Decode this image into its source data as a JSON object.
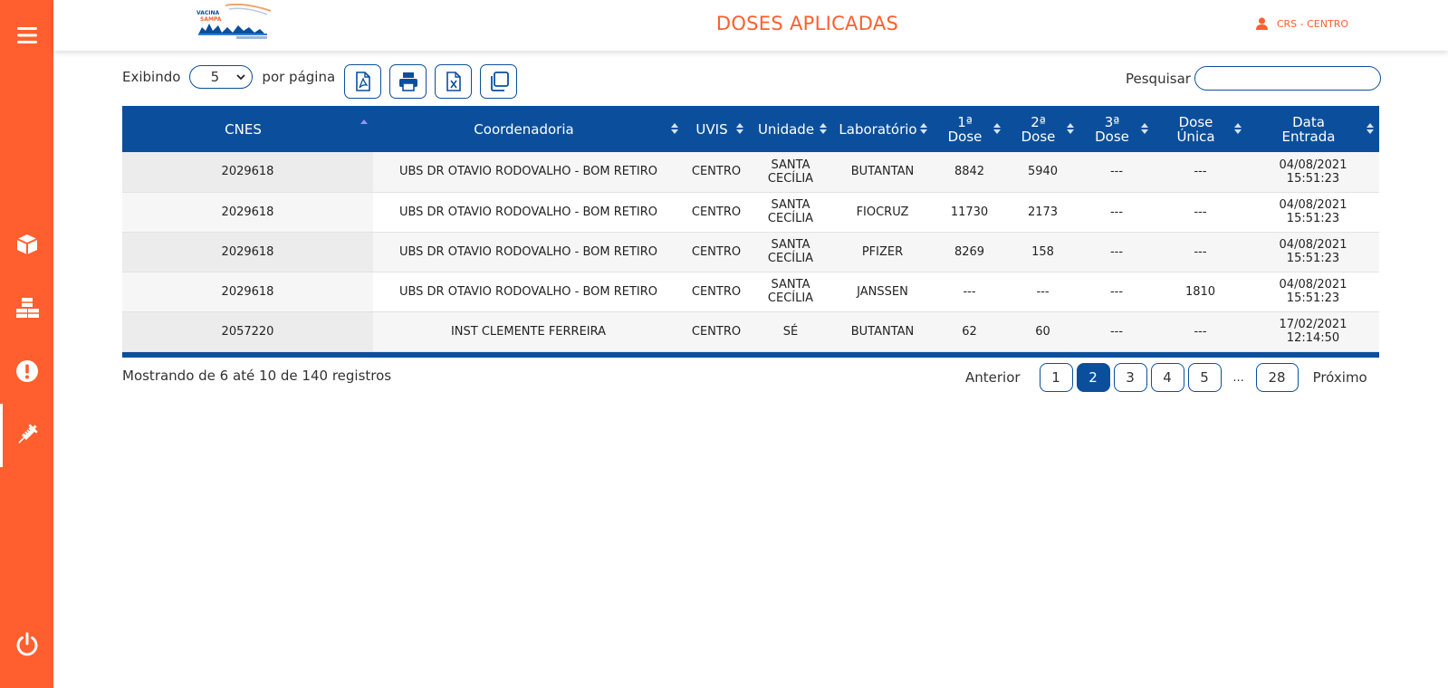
{
  "header": {
    "title": "DOSES APLICADAS",
    "user": "CRS - CENTRO",
    "logo_text": "VACINA SAMPA"
  },
  "sidebar": {
    "items": [
      {
        "icon": "menu-icon"
      },
      {
        "icon": "box-icon"
      },
      {
        "icon": "boxes-icon"
      },
      {
        "icon": "alert-icon"
      },
      {
        "icon": "syringe-icon",
        "active": true
      },
      {
        "icon": "power-icon"
      }
    ]
  },
  "toolbar": {
    "showing_label": "Exibindo",
    "per_page_value": "5",
    "per_page_label": "por página",
    "buttons": [
      "pdf-icon",
      "print-icon",
      "excel-icon",
      "copy-icon"
    ]
  },
  "search": {
    "label": "Pesquisar",
    "value": ""
  },
  "table": {
    "columns": [
      {
        "label": "CNES",
        "sort": "asc"
      },
      {
        "label": "Coordenadoria",
        "sort": "both"
      },
      {
        "label": "UVIS",
        "sort": "both"
      },
      {
        "label": "Unidade",
        "sort": "both"
      },
      {
        "label": "Laboratório",
        "sort": "both"
      },
      {
        "label": "1ª Dose",
        "line1": "1ª",
        "line2": "Dose",
        "sort": "both"
      },
      {
        "label": "2ª Dose",
        "line1": "2ª",
        "line2": "Dose",
        "sort": "both"
      },
      {
        "label": "3ª Dose",
        "line1": "3ª",
        "line2": "Dose",
        "sort": "both"
      },
      {
        "label": "Dose Única",
        "line1": "Dose",
        "line2": "Única",
        "sort": "both"
      },
      {
        "label": "Data Entrada",
        "line1": "Data",
        "line2": "Entrada",
        "sort": "both"
      }
    ],
    "rows": [
      {
        "cnes": "2029618",
        "coordenadoria": "UBS DR OTAVIO RODOVALHO - BOM RETIRO",
        "uvis": "CENTRO",
        "unidade1": "SANTA",
        "unidade2": "CECÍLIA",
        "laboratorio": "BUTANTAN",
        "dose1": "8842",
        "dose2": "5940",
        "dose3": "---",
        "unica": "---",
        "data": "04/08/2021",
        "hora": "15:51:23"
      },
      {
        "cnes": "2029618",
        "coordenadoria": "UBS DR OTAVIO RODOVALHO - BOM RETIRO",
        "uvis": "CENTRO",
        "unidade1": "SANTA",
        "unidade2": "CECÍLIA",
        "laboratorio": "FIOCRUZ",
        "dose1": "11730",
        "dose2": "2173",
        "dose3": "---",
        "unica": "---",
        "data": "04/08/2021",
        "hora": "15:51:23"
      },
      {
        "cnes": "2029618",
        "coordenadoria": "UBS DR OTAVIO RODOVALHO - BOM RETIRO",
        "uvis": "CENTRO",
        "unidade1": "SANTA",
        "unidade2": "CECÍLIA",
        "laboratorio": "PFIZER",
        "dose1": "8269",
        "dose2": "158",
        "dose3": "---",
        "unica": "---",
        "data": "04/08/2021",
        "hora": "15:51:23"
      },
      {
        "cnes": "2029618",
        "coordenadoria": "UBS DR OTAVIO RODOVALHO - BOM RETIRO",
        "uvis": "CENTRO",
        "unidade1": "SANTA",
        "unidade2": "CECÍLIA",
        "laboratorio": "JANSSEN",
        "dose1": "---",
        "dose2": "---",
        "dose3": "---",
        "unica": "1810",
        "data": "04/08/2021",
        "hora": "15:51:23"
      },
      {
        "cnes": "2057220",
        "coordenadoria": "INST CLEMENTE FERREIRA",
        "uvis": "CENTRO",
        "unidade1": "SÉ",
        "unidade2": "",
        "laboratorio": "BUTANTAN",
        "dose1": "62",
        "dose2": "60",
        "dose3": "---",
        "unica": "---",
        "data": "17/02/2021",
        "hora": "12:14:50"
      }
    ]
  },
  "info": "Mostrando de 6 até 10 de 140 registros",
  "pagination": {
    "previous": "Anterior",
    "pages": [
      "1",
      "2",
      "3",
      "4",
      "5"
    ],
    "current": "2",
    "ellipsis": "...",
    "last": "28",
    "next": "Próximo"
  },
  "colors": {
    "accent": "#ff5f2e",
    "primary": "#0b4f9c"
  }
}
